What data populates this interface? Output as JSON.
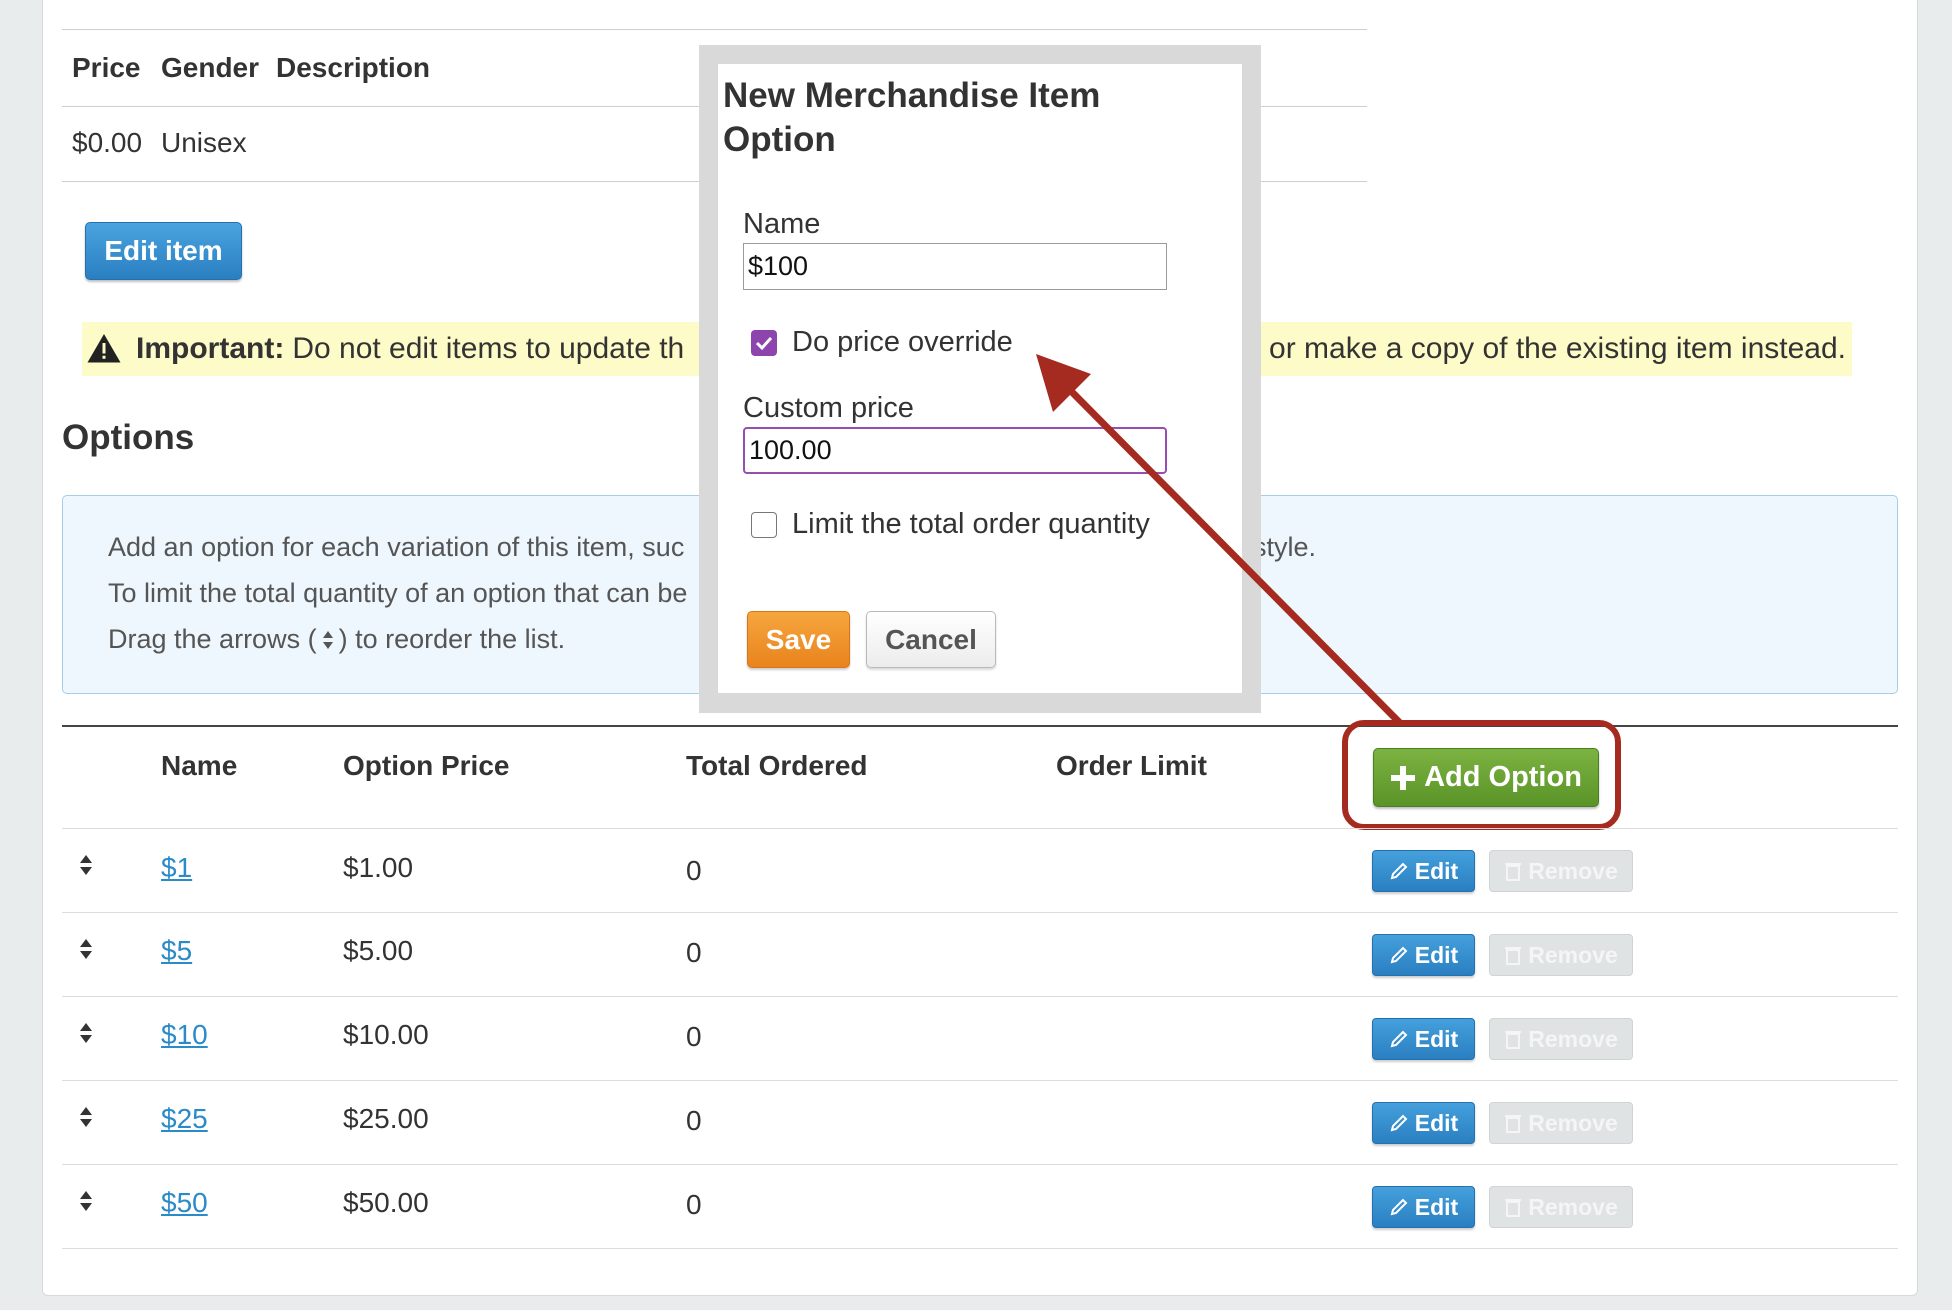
{
  "item_table": {
    "headers": [
      "Price",
      "Gender",
      "Description"
    ],
    "row": {
      "price": "$0.00",
      "gender": "Unisex"
    }
  },
  "edit_item_label": "Edit item",
  "warning": {
    "strong": "Important:",
    "text": "Do not edit items to update th",
    "tail": "or make a copy of the existing item instead."
  },
  "options_heading": "Options",
  "info": {
    "line1": "Add an option for each variation of this item, suc",
    "line1_tail": "style.",
    "line2": "To limit the total quantity of an option that can be",
    "line3_pre": "Drag the arrows (",
    "line3_post": ") to reorder the list."
  },
  "options_table": {
    "headers": {
      "name": "Name",
      "price": "Option Price",
      "ordered": "Total Ordered",
      "limit": "Order Limit"
    },
    "add_option_label": "Add Option",
    "edit_label": "Edit",
    "remove_label": "Remove",
    "rows": [
      {
        "name": "$1",
        "price": "$1.00",
        "ordered": "0"
      },
      {
        "name": "$5",
        "price": "$5.00",
        "ordered": "0"
      },
      {
        "name": "$10",
        "price": "$10.00",
        "ordered": "0"
      },
      {
        "name": "$25",
        "price": "$25.00",
        "ordered": "0"
      },
      {
        "name": "$50",
        "price": "$50.00",
        "ordered": "0"
      }
    ]
  },
  "modal": {
    "title": "New Merchandise Item Option",
    "name_label": "Name",
    "name_value": "$100",
    "price_override_label": "Do price override",
    "price_override_checked": true,
    "custom_price_label": "Custom price",
    "custom_price_value": "100.00",
    "limit_label": "Limit the total order quantity",
    "limit_checked": false,
    "save_label": "Save",
    "cancel_label": "Cancel"
  },
  "colors": {
    "annotation": "#a52a1f",
    "primary": "#2a7fc1",
    "success": "#5a9327",
    "warning_bg": "#fdfbc7",
    "checkbox": "#8e44ad"
  }
}
